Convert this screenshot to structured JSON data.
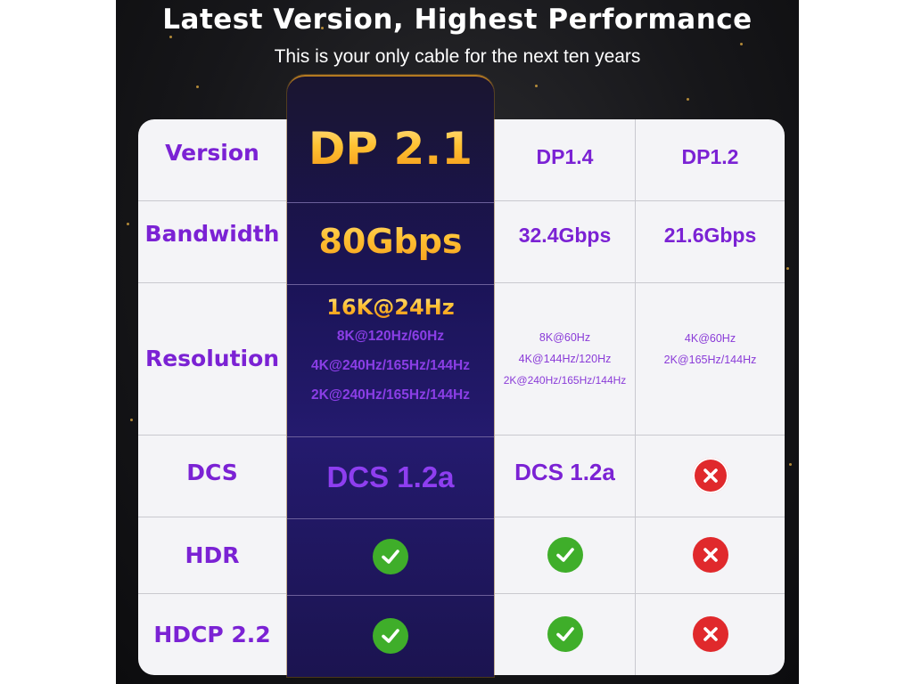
{
  "header": {
    "title": "Latest Version, Highest Performance",
    "subtitle": "This is your only cable for the next ten years"
  },
  "table": {
    "rows": {
      "version": {
        "label": "Version",
        "dp21": "DP 2.1",
        "dp14": "DP1.4",
        "dp12": "DP1.2"
      },
      "bandwidth": {
        "label": "Bandwidth",
        "dp21": "80Gbps",
        "dp14": "32.4Gbps",
        "dp12": "21.6Gbps"
      },
      "resolution": {
        "label": "Resolution",
        "dp21_headline": "16K@24Hz",
        "dp21": [
          "8K@120Hz/60Hz",
          "4K@240Hz/165Hz/144Hz",
          "2K@240Hz/165Hz/144Hz"
        ],
        "dp14": [
          "8K@60Hz",
          "4K@144Hz/120Hz",
          "2K@240Hz/165Hz/144Hz"
        ],
        "dp12": [
          "4K@60Hz",
          "2K@165Hz/144Hz"
        ]
      },
      "dcs": {
        "label": "DCS",
        "dp21": "DCS 1.2a",
        "dp14": "DCS 1.2a",
        "dp12_icon": "cross-icon"
      },
      "hdr": {
        "label": "HDR",
        "dp21_icon": "check-icon",
        "dp14_icon": "check-icon",
        "dp12_icon": "cross-icon"
      },
      "hdcp": {
        "label": "HDCP 2.2",
        "dp21_icon": "check-icon",
        "dp14_icon": "check-icon",
        "dp12_icon": "cross-icon"
      }
    }
  },
  "colors": {
    "label_purple": "#7b22d4",
    "check_green": "#3fae2a",
    "cross_red": "#e0292c",
    "gold": "#ffc233"
  }
}
